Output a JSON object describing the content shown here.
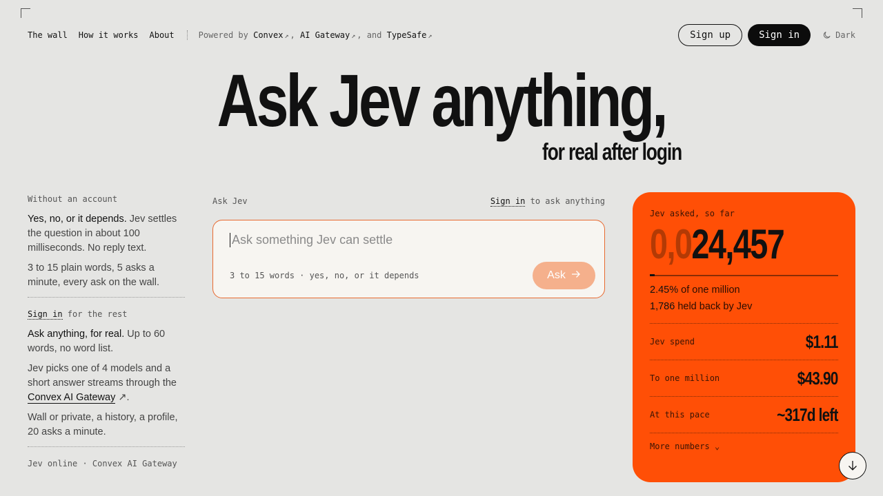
{
  "nav": {
    "links": [
      "The wall",
      "How it works",
      "About"
    ],
    "powered_prefix": "Powered by",
    "powered_convex": "Convex",
    "powered_gateway": "AI Gateway",
    "powered_and": ", and",
    "powered_typesafe": "TypeSafe",
    "sign_up": "Sign up",
    "sign_in": "Sign in",
    "theme": "Dark"
  },
  "hero": {
    "title": "Ask Jev anything,",
    "subtitle": "for real after login"
  },
  "left": {
    "label_no_account": "Without an account",
    "p1_strong": "Yes, no, or it depends.",
    "p1_rest": " Jev settles the question in about 100 milliseconds. No reply text.",
    "p2": "3 to 15 plain words, 5 asks a minute, every ask on the wall.",
    "label_signin": "Sign in",
    "label_signin_rest": " for the rest",
    "p3_strong": "Ask anything, for real.",
    "p3_rest": " Up to 60 words, no word list.",
    "p4_a": "Jev picks one of 4 models and a short answer streams through the ",
    "p4_link": "Convex AI Gateway",
    "p4_b": ".",
    "p5": "Wall or private, a history, a profile, 20 asks a minute.",
    "footer": "Jev online · Convex AI Gateway"
  },
  "center": {
    "label": "Ask Jev",
    "signin": "Sign in",
    "signin_rest": " to ask anything",
    "placeholder": "Ask something Jev can settle",
    "hint": "3 to 15 words · yes, no, or it depends",
    "ask_button": "Ask"
  },
  "card": {
    "label": "Jev asked, so far",
    "counter_dim": "0,0",
    "counter_bright": "24,457",
    "progress_fraction": 0.0245,
    "pct_value": "2.45%",
    "pct_rest": " of one million",
    "held_value": "1,786",
    "held_rest": " held back by Jev",
    "rows": [
      {
        "label": "Jev spend",
        "value": "$1.11"
      },
      {
        "label": "To one million",
        "value": "$43.90"
      },
      {
        "label": "At this pace",
        "value": "~317d left"
      }
    ],
    "more": "More numbers"
  },
  "colors": {
    "accent": "#ff4f06",
    "background": "#e5e5e3",
    "ask_button": "#f5b08c"
  }
}
